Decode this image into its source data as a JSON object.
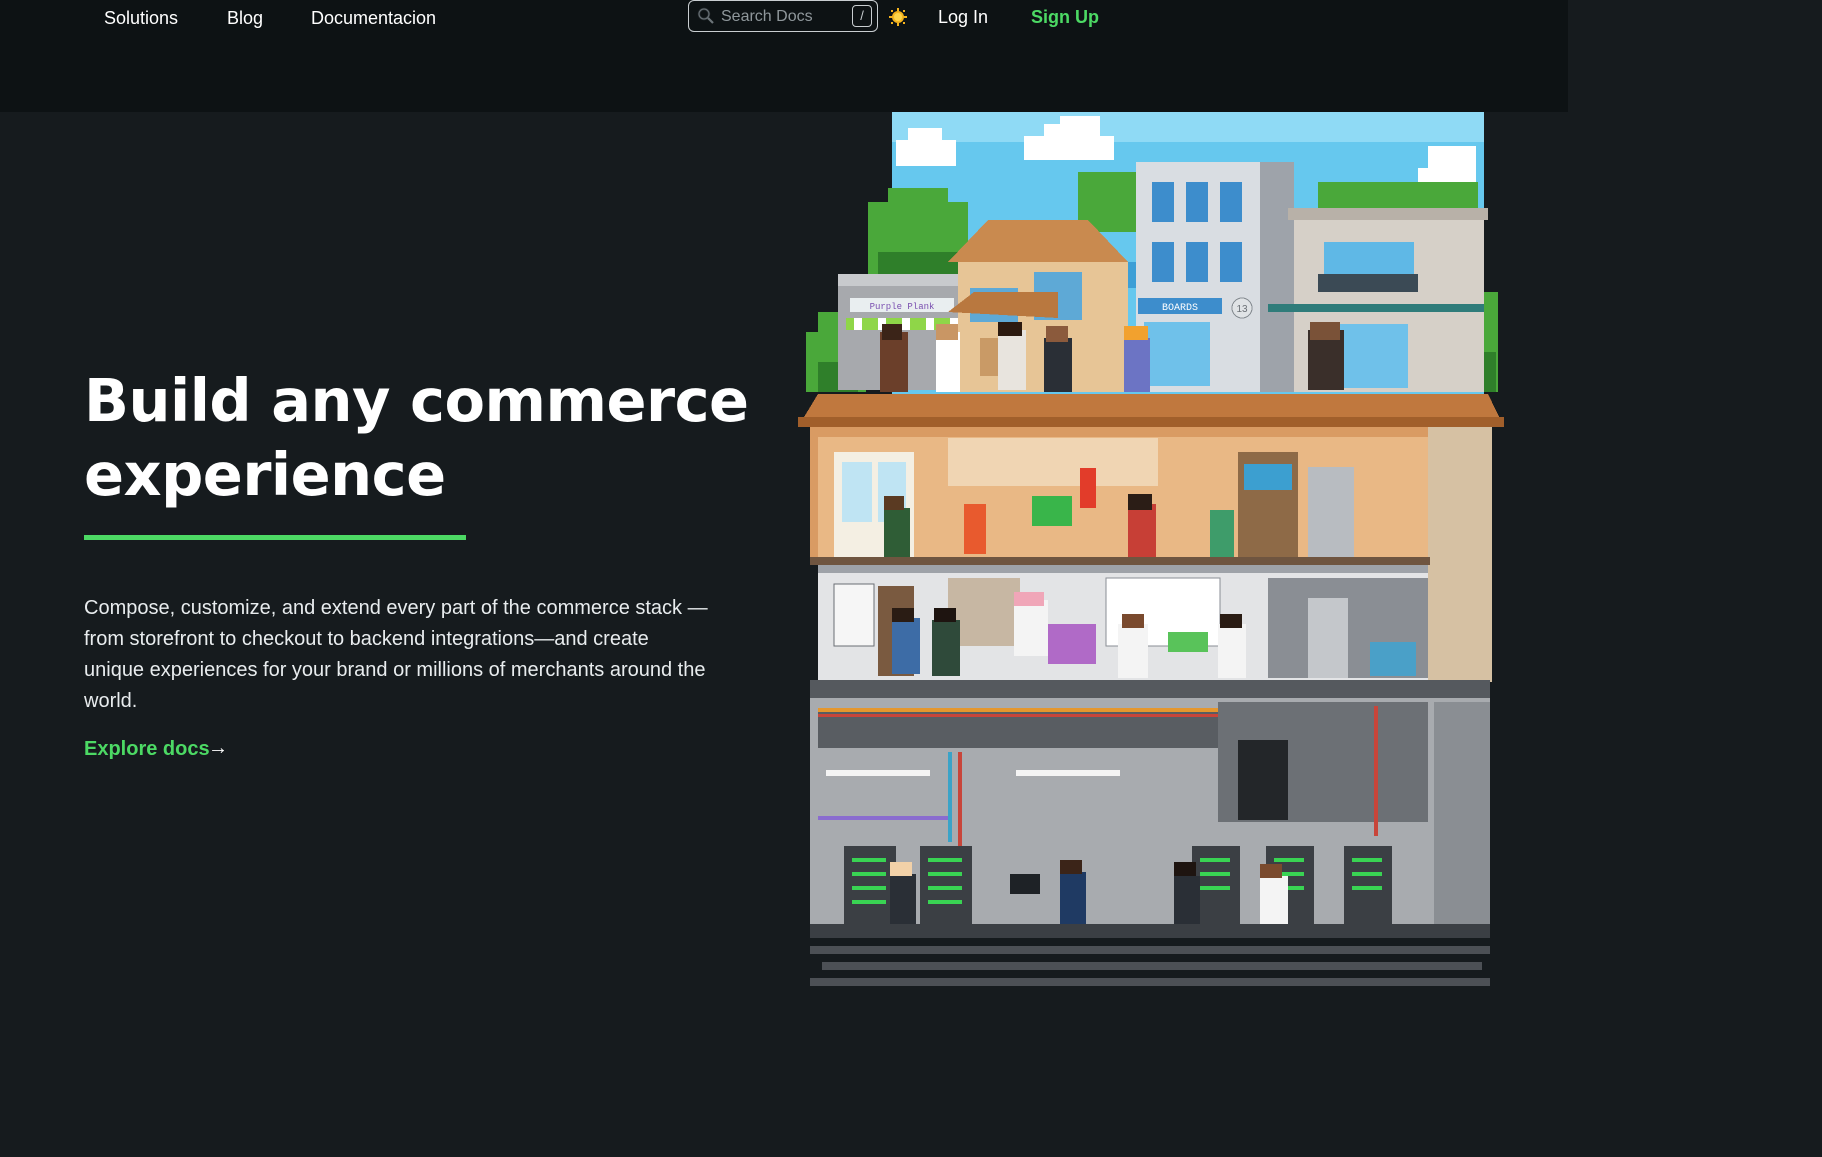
{
  "nav": {
    "links": [
      "Solutions",
      "Blog",
      "Documentacion"
    ],
    "search_placeholder": "Search Docs",
    "search_shortcut": "/",
    "login": "Log In",
    "signup": "Sign Up"
  },
  "hero": {
    "title_line1": "Build any commerce",
    "title_line2": "experience",
    "description": "Compose, customize, and extend every part of the commerce stack —from storefront to checkout to backend integrations—and create unique experiences for your brand or millions of merchants around the world.",
    "cta": "Explore docs",
    "cta_arrow": "→"
  },
  "illustration": {
    "storefront_sign": "Purple Plank",
    "boards_sign": "BOARDS",
    "address_number": "13"
  },
  "colors": {
    "accent_green": "#4cd964",
    "background": "#161b1e",
    "topbar": "#0d1214"
  },
  "icons": [
    "search-icon",
    "sun-icon",
    "arrow-right-icon"
  ]
}
